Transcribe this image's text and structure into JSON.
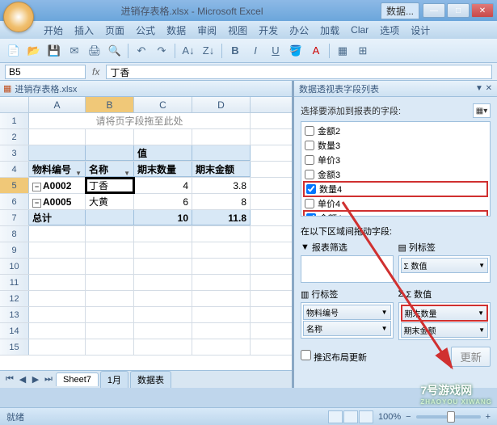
{
  "window": {
    "title": "进销存表格.xlsx - Microsoft Excel",
    "context_tab": "数据..."
  },
  "menu": [
    "开始",
    "插入",
    "页面",
    "公式",
    "数据",
    "审阅",
    "视图",
    "开发",
    "办公",
    "加载",
    "Clar",
    "选项",
    "设计"
  ],
  "namebox": "B5",
  "fx": "fx",
  "formula_value": "丁香",
  "workbook_tab": "进销存表格.xlsx",
  "columns": [
    "A",
    "B",
    "C",
    "D"
  ],
  "page_drop_hint": "请将页字段拖至此处",
  "pivot": {
    "value_header": "值",
    "row_labels": [
      "物料编号",
      "名称"
    ],
    "col_labels": [
      "期末数量",
      "期末金额"
    ],
    "rows": [
      {
        "code": "A0002",
        "name": "丁香",
        "qty": "4",
        "amt": "3.8"
      },
      {
        "code": "A0005",
        "name": "大黄",
        "qty": "6",
        "amt": "8"
      }
    ],
    "total_label": "总计",
    "totals": {
      "qty": "10",
      "amt": "11.8"
    }
  },
  "sheet_tabs": [
    "Sheet7",
    "1月",
    "数据表"
  ],
  "field_pane": {
    "title": "数据透视表字段列表",
    "prompt": "选择要添加到报表的字段:",
    "fields": [
      {
        "label": "金额2",
        "checked": false,
        "hl": false
      },
      {
        "label": "数量3",
        "checked": false,
        "hl": false
      },
      {
        "label": "单价3",
        "checked": false,
        "hl": false
      },
      {
        "label": "金额3",
        "checked": false,
        "hl": false
      },
      {
        "label": "数量4",
        "checked": true,
        "hl": true
      },
      {
        "label": "单价4",
        "checked": false,
        "hl": false
      },
      {
        "label": "金额4",
        "checked": true,
        "hl": true
      }
    ],
    "drag_prompt": "在以下区域间拖动字段:",
    "zones": {
      "filter": {
        "label": "报表筛选",
        "items": []
      },
      "columns": {
        "label": "列标签",
        "items": [
          {
            "t": "Σ 数值",
            "hl": false
          }
        ]
      },
      "rows": {
        "label": "行标签",
        "items": [
          {
            "t": "物料编号",
            "hl": false
          },
          {
            "t": "名称",
            "hl": false
          }
        ]
      },
      "values": {
        "label": "Σ 数值",
        "items": [
          {
            "t": "期末数量",
            "hl": true
          },
          {
            "t": "期末金额",
            "hl": false
          }
        ]
      }
    },
    "defer": "推迟布局更新",
    "update": "更新"
  },
  "status": {
    "ready": "就绪",
    "zoom": "100%"
  },
  "watermark": {
    "brand": "7号游戏网",
    "sub": "ZHAOYOU XIWANG"
  }
}
